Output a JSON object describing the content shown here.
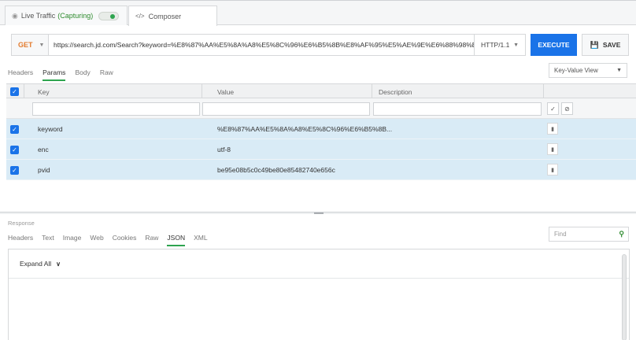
{
  "tabs": {
    "live_traffic_label": "Live Traffic",
    "capturing_label": "(Capturing)",
    "composer_label": "Composer"
  },
  "request": {
    "method": "GET",
    "url": "https://search.jd.com/Search?keyword=%E8%87%AA%E5%8A%A8%E5%8C%96%E6%B5%8B%E8%AF%95%E5%AE%9E%E6%88%98%E5%AE%9(",
    "http_version": "HTTP/1.1",
    "execute_label": "EXECUTE",
    "save_label": "SAVE"
  },
  "request_tabs": [
    "Headers",
    "Params",
    "Body",
    "Raw"
  ],
  "request_tabs_active": "Params",
  "view_select": "Key-Value View",
  "params": {
    "columns": {
      "key": "Key",
      "value": "Value",
      "description": "Description"
    },
    "rows": [
      {
        "checked": true,
        "key": "keyword",
        "value": "%E8%87%AA%E5%8A%A8%E5%8C%96%E6%B5%8B...",
        "description": ""
      },
      {
        "checked": true,
        "key": "enc",
        "value": "utf-8",
        "description": ""
      },
      {
        "checked": true,
        "key": "pvid",
        "value": "be95e08b5c0c49be80e85482740e656c",
        "description": ""
      }
    ]
  },
  "response": {
    "label": "Response",
    "tabs": [
      "Headers",
      "Text",
      "Image",
      "Web",
      "Cookies",
      "Raw",
      "JSON",
      "XML"
    ],
    "active_tab": "JSON",
    "find_placeholder": "Find",
    "expand_all_label": "Expand All"
  },
  "colors": {
    "accent_green": "#2ea44f",
    "execute_blue": "#1a73e8",
    "method_orange": "#e37b2e",
    "row_selected": "#d9ebf6"
  }
}
